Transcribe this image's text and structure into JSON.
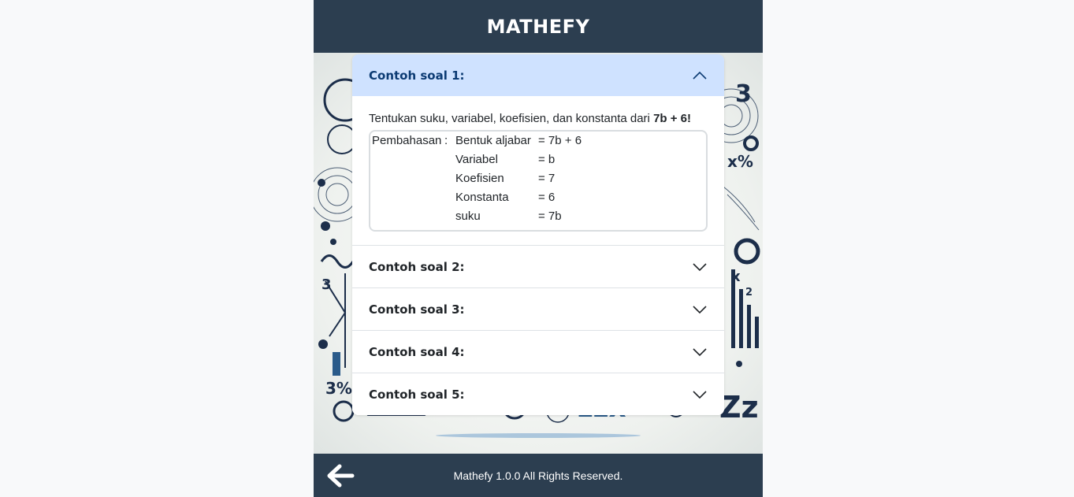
{
  "app": {
    "title": "MATHEFY"
  },
  "accordion": {
    "items": [
      {
        "title": "Contoh soal 1:",
        "expanded": true,
        "question_text": "Tentukan suku, variabel, koefisien, dan konstanta dari ",
        "question_expr": "7b + 6!",
        "solution": {
          "label": "Pembahasan",
          "colon": ":",
          "rows": [
            {
              "term": "Bentuk aljabar",
              "value": "= 7b + 6"
            },
            {
              "term": "Variabel",
              "value": "= b"
            },
            {
              "term": "Koefisien",
              "value": "= 7"
            },
            {
              "term": "Konstanta",
              "value": "= 6"
            },
            {
              "term": "suku",
              "value": "= 7b"
            }
          ]
        }
      },
      {
        "title": "Contoh soal 2:",
        "expanded": false
      },
      {
        "title": "Contoh soal 3:",
        "expanded": false
      },
      {
        "title": "Contoh soal 4:",
        "expanded": false
      },
      {
        "title": "Contoh soal 5:",
        "expanded": false
      }
    ],
    "icons": {
      "expanded": "chevron-up-icon",
      "collapsed": "chevron-down-icon"
    }
  },
  "footer": {
    "copyright": "Mathefy 1.0.0 All Rights Reserved.",
    "back_icon": "arrow-left-icon"
  },
  "colors": {
    "header_bg": "#2c3e50",
    "active_header_bg": "#cfe2ff",
    "active_title": "#0c3b73"
  }
}
